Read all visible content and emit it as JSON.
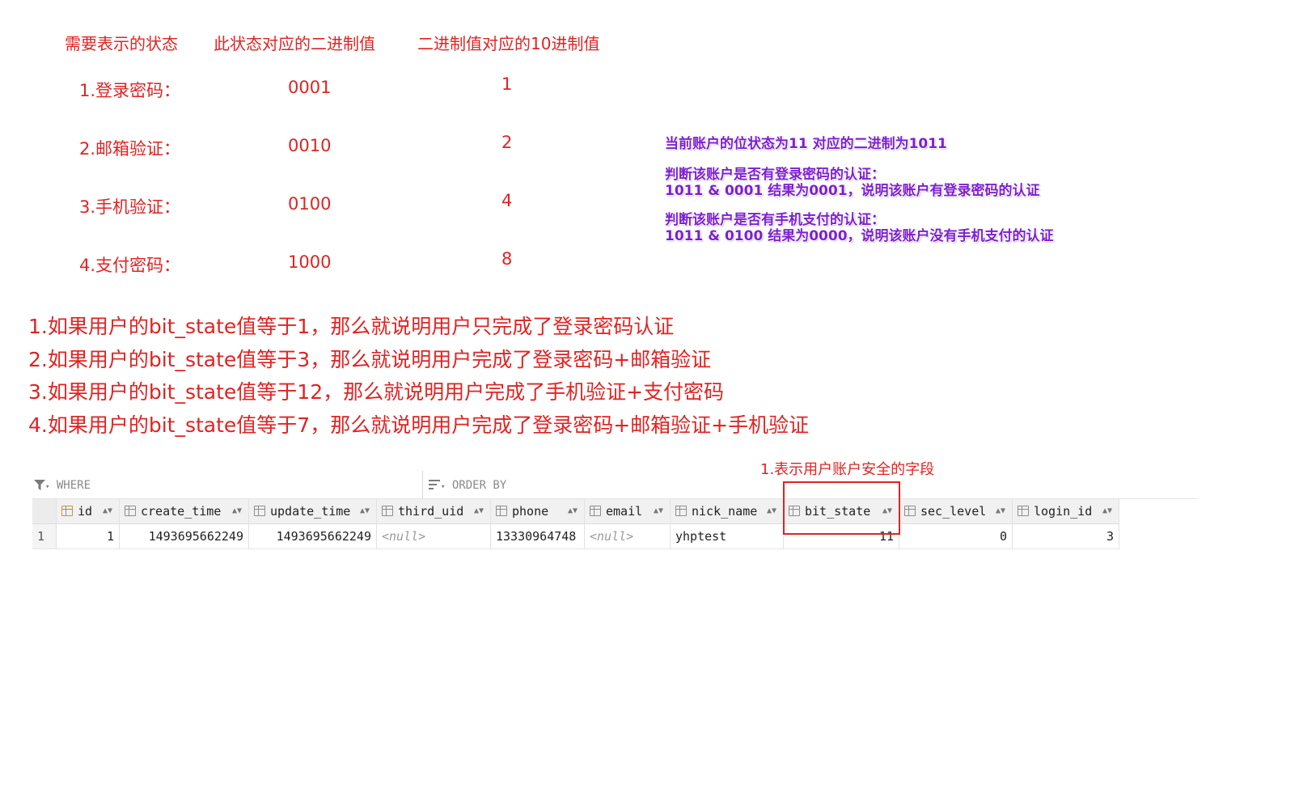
{
  "headers": {
    "state": "需要表示的状态",
    "binary": "此状态对应的二进制值",
    "decimal": "二进制值对应的10进制值"
  },
  "states": [
    {
      "label": "1.登录密码：",
      "binary": "0001",
      "decimal": "1"
    },
    {
      "label": "2.邮箱验证：",
      "binary": "0010",
      "decimal": "2"
    },
    {
      "label": "3.手机验证：",
      "binary": "0100",
      "decimal": "4"
    },
    {
      "label": "4.支付密码：",
      "binary": "1000",
      "decimal": "8"
    }
  ],
  "note": {
    "line1": "当前账户的位状态为11 对应的二进制为1011",
    "line2": "判断该账户是否有登录密码的认证：",
    "line3": "1011 & 0001 结果为0001，说明该账户有登录密码的认证",
    "line4": "判断该账户是否有手机支付的认证：",
    "line5": "1011 & 0100 结果为0000，说明该账户没有手机支付的认证"
  },
  "rules": [
    "1.如果用户的bit_state值等于1，那么就说明用户只完成了登录密码认证",
    "2.如果用户的bit_state值等于3，那么就说明用户完成了登录密码+邮箱验证",
    "3.如果用户的bit_state值等于12，那么就说明用户完成了手机验证+支付密码",
    "4.如果用户的bit_state值等于7，那么就说明用户完成了登录密码+邮箱验证+手机验证"
  ],
  "annotation": "1.表示用户账户安全的字段",
  "toolbar": {
    "where": "WHERE",
    "order_by": "ORDER BY"
  },
  "grid": {
    "columns": [
      "id",
      "create_time",
      "update_time",
      "third_uid",
      "phone",
      "email",
      "nick_name",
      "bit_state",
      "sec_level",
      "login_id"
    ],
    "row": {
      "num": "1",
      "id": "1",
      "create_time": "1493695662249",
      "update_time": "1493695662249",
      "third_uid": "<null>",
      "phone": "13330964748",
      "email": "<null>",
      "nick_name": "yhptest",
      "bit_state": "11",
      "sec_level": "0",
      "login_id": "3"
    }
  },
  "colors": {
    "accent_red": "#e02323",
    "note_purple": "#7c1fd1"
  }
}
